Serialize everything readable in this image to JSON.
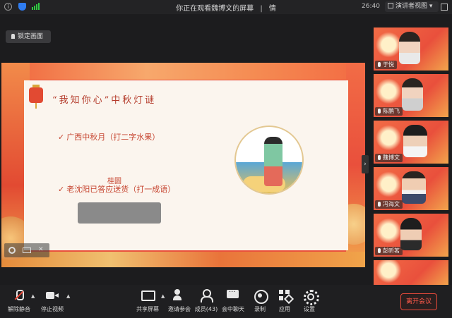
{
  "window": {
    "title": "你正在观看魏博文的屏幕",
    "title_right_glyph": "情",
    "clock": "26:40",
    "view_button": "演讲者视图"
  },
  "lock_screen_button": "锁定画面",
  "slide": {
    "title": "“我知你心”中秋灯谜",
    "riddle1": "广西中秋月（打二字水果）",
    "answer1": "桂圆",
    "riddle2": "老沈阳已答应送货（打一成语）",
    "check_mark": "✓"
  },
  "participants": [
    {
      "name": "于悦"
    },
    {
      "name": "陈鹏飞"
    },
    {
      "name": "魏博文"
    },
    {
      "name": "冯海文"
    },
    {
      "name": "彭昕茗"
    },
    {
      "name": ""
    }
  ],
  "toolbar": {
    "mute": "解除静音",
    "stop_video": "停止视频",
    "share_screen": "共享屏幕",
    "invite": "邀请参会",
    "members": "成员(43)",
    "chat": "会中聊天",
    "record": "录制",
    "apps": "应用",
    "settings": "设置",
    "leave": "离开会议"
  },
  "colors": {
    "accent_red": "#e84a3a",
    "slide_red": "#e9503c",
    "toolbar_bg": "#1f1f21"
  }
}
